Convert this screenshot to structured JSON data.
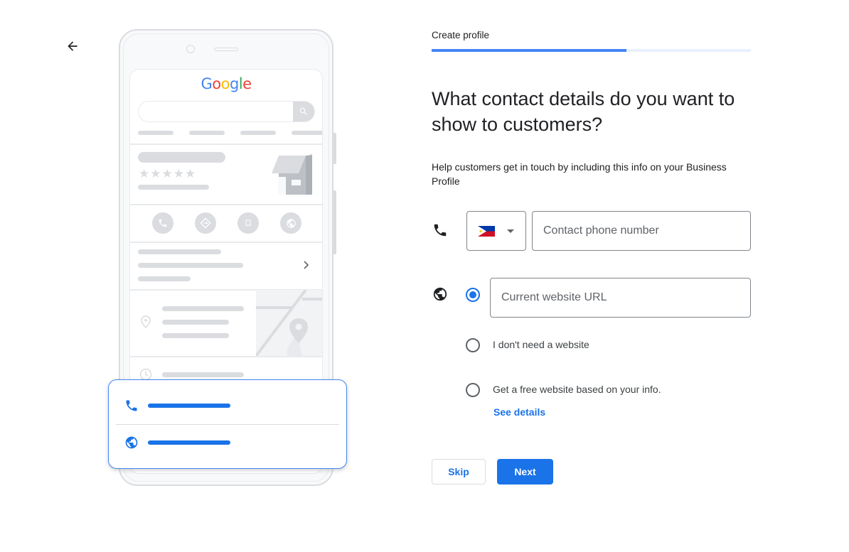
{
  "nav": {
    "back_icon": "arrow-back-icon"
  },
  "illustration": {
    "logo_letters": [
      "G",
      "o",
      "o",
      "g",
      "l",
      "e"
    ],
    "icons": [
      "search-icon",
      "storefront-icon",
      "star-icon",
      "phone-icon",
      "directions-icon",
      "bookmark-icon",
      "globe-icon",
      "chevron-right-icon",
      "location-pin-icon",
      "map-icon",
      "clock-icon"
    ],
    "stars": 5
  },
  "contact_card": {
    "icons": [
      "phone-icon",
      "globe-icon"
    ]
  },
  "header": {
    "step_label": "Create profile",
    "progress_percent": 61
  },
  "main": {
    "title": "What contact details do you want to show to customers?",
    "subtitle": "Help customers get in touch by including this info on your Business Profile",
    "phone": {
      "icon": "phone-icon",
      "country_code": "PH",
      "country_flag": "philippines-flag",
      "value": "",
      "placeholder": "Contact phone number"
    },
    "website": {
      "icon": "globe-icon",
      "options": [
        {
          "label": "",
          "value": "",
          "placeholder": "Current website URL",
          "selected": true
        },
        {
          "label": "I don't need a website",
          "selected": false
        },
        {
          "label": "Get a free website based on your info.",
          "selected": false,
          "link": "See details"
        }
      ]
    }
  },
  "actions": {
    "skip_label": "Skip",
    "next_label": "Next"
  },
  "colors": {
    "primary": "#1a73e8",
    "progress_fill": "#4285f4",
    "progress_track": "#e8f0fe",
    "border": "#80868b"
  }
}
